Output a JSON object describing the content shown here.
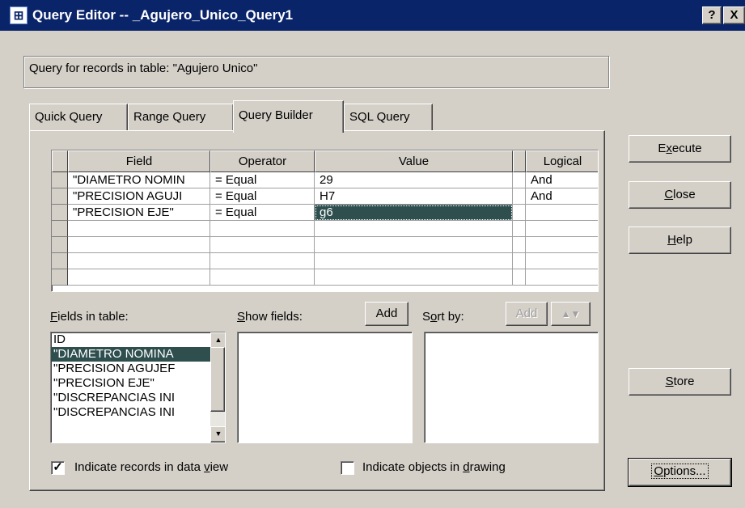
{
  "window": {
    "title": "Query Editor -- _Agujero_Unico_Query1",
    "help_btn": "?",
    "close_btn": "X"
  },
  "table_label": "Query for records in table:  \"Agujero Unico\"",
  "tabs": [
    {
      "label": "Quick Query",
      "active": false
    },
    {
      "label": "Range Query",
      "active": false
    },
    {
      "label": "Query Builder",
      "active": true
    },
    {
      "label": "SQL Query",
      "active": false
    }
  ],
  "grid": {
    "headers": [
      "Field",
      "Operator",
      "Value",
      "Logical"
    ],
    "rows": [
      {
        "field": "\"DIAMETRO NOMIN",
        "operator": "=  Equal",
        "value": "29",
        "logical": "And"
      },
      {
        "field": "\"PRECISION AGUJI",
        "operator": "=  Equal",
        "value": "H7",
        "logical": "And"
      },
      {
        "field": "\"PRECISION EJE\"",
        "operator": "=  Equal",
        "value": "g6",
        "logical": ""
      }
    ]
  },
  "fields_in_table": {
    "label_prefix": "",
    "label_hotkey": "F",
    "label_rest": "ields in table:",
    "items": [
      "ID",
      "\"DIAMETRO NOMINA",
      "\"PRECISION AGUJEF",
      "\"PRECISION EJE\"",
      "\"DISCREPANCIAS INI",
      "\"DISCREPANCIAS INI"
    ],
    "selected_index": 1
  },
  "show_fields": {
    "label_hotkey": "S",
    "label_rest": "how fields:",
    "add_label": "Add"
  },
  "sort_by": {
    "label_pre": "S",
    "label_hotkey": "o",
    "label_rest": "rt by:",
    "add_label": "Add",
    "order_label": "▲▼"
  },
  "checkboxes": {
    "records": {
      "label_pre": "Indicate records in data ",
      "label_hotkey": "v",
      "label_rest": "iew",
      "checked": true,
      "mark": "✓"
    },
    "objects": {
      "label_pre": "Indicate objects in ",
      "label_hotkey": "d",
      "label_rest": "rawing",
      "checked": false
    }
  },
  "buttons": {
    "execute": {
      "pre": "E",
      "hotkey": "x",
      "rest": "ecute"
    },
    "close": {
      "pre": "",
      "hotkey": "C",
      "rest": "lose"
    },
    "help": {
      "pre": "",
      "hotkey": "H",
      "rest": "elp"
    },
    "store": {
      "pre": "",
      "hotkey": "S",
      "rest": "tore"
    },
    "options": {
      "pre": "",
      "hotkey": "O",
      "rest": "ptions..."
    }
  }
}
